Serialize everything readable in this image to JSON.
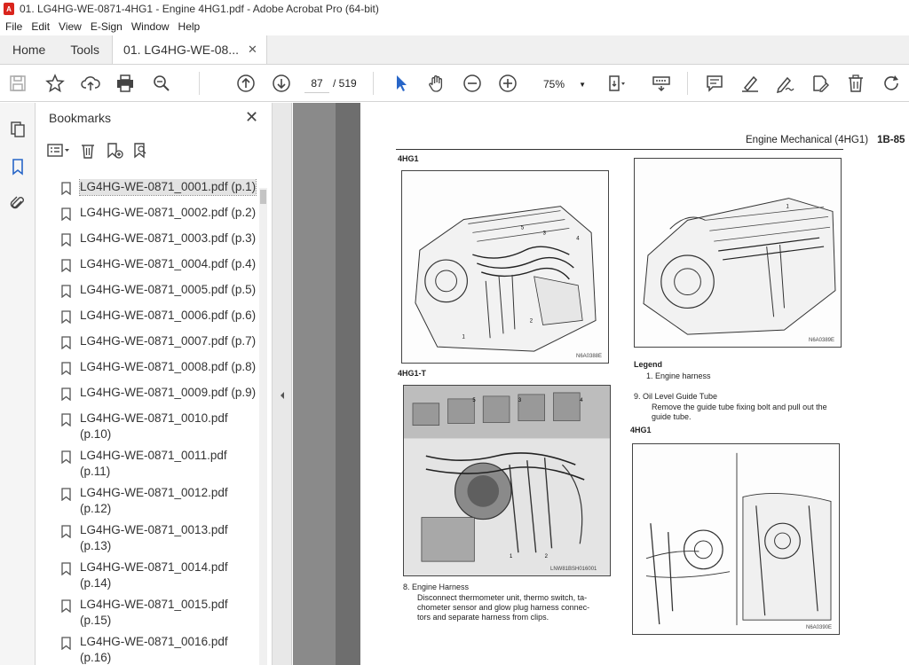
{
  "window": {
    "title": "01. LG4HG-WE-0871-4HG1 - Engine 4HG1.pdf - Adobe Acrobat Pro (64-bit)"
  },
  "menu": [
    "File",
    "Edit",
    "View",
    "E-Sign",
    "Window",
    "Help"
  ],
  "tabs": {
    "home": "Home",
    "tools": "Tools",
    "document": "01. LG4HG-WE-08...",
    "close": "✕"
  },
  "toolbar": {
    "page_current": "87",
    "page_total": "/ 519",
    "zoom": "75%"
  },
  "panel": {
    "title": "Bookmarks",
    "close": "✕",
    "items": [
      "LG4HG-WE-0871_0001.pdf (p.1)",
      "LG4HG-WE-0871_0002.pdf (p.2)",
      "LG4HG-WE-0871_0003.pdf (p.3)",
      "LG4HG-WE-0871_0004.pdf (p.4)",
      "LG4HG-WE-0871_0005.pdf (p.5)",
      "LG4HG-WE-0871_0006.pdf (p.6)",
      "LG4HG-WE-0871_0007.pdf (p.7)",
      "LG4HG-WE-0871_0008.pdf (p.8)",
      "LG4HG-WE-0871_0009.pdf (p.9)",
      "LG4HG-WE-0871_0010.pdf (p.10)",
      "LG4HG-WE-0871_0011.pdf (p.11)",
      "LG4HG-WE-0871_0012.pdf (p.12)",
      "LG4HG-WE-0871_0013.pdf (p.13)",
      "LG4HG-WE-0871_0014.pdf (p.14)",
      "LG4HG-WE-0871_0015.pdf (p.15)",
      "LG4HG-WE-0871_0016.pdf (p.16)"
    ]
  },
  "document": {
    "header": "Engine Mechanical (4HG1)",
    "page_no": "1B-85",
    "label_4hg1_a": "4HG1",
    "label_4hg1t": "4HG1-T",
    "label_4hg1_b": "4HG1",
    "fig1_code": "N6A0388E",
    "fig2_code": "N6A0389E",
    "fig3_code": "LNW81BSH016001",
    "fig4_code": "N6A0390E",
    "legend_title": "Legend",
    "legend_item": "1.   Engine harness",
    "step9_title": "9.   Oil Level Guide Tube",
    "step9_line1": "Remove the guide tube fixing bolt and pull out the",
    "step9_line2": "guide tube.",
    "step8_title": "8.   Engine Harness",
    "step8_line1": "Disconnect thermometer unit, thermo switch, ta-",
    "step8_line2": "chometer sensor and glow plug harness connec-",
    "step8_line3": "tors and separate harness from clips."
  }
}
